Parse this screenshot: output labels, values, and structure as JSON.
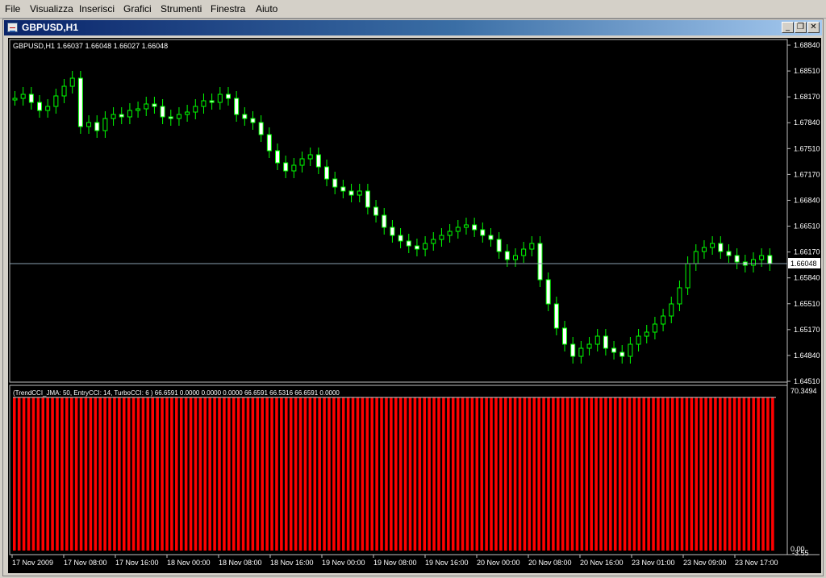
{
  "menu": {
    "items": [
      "File",
      "Visualizza",
      "Inserisci",
      "Grafici",
      "Strumenti",
      "Finestra",
      "Aiuto"
    ]
  },
  "window": {
    "title": "GBPUSD,H1",
    "minimize_icon": "minimize-icon",
    "restore_icon": "restore-icon",
    "close_icon": "close-icon"
  },
  "chart": {
    "header": "GBPUSD,H1  1.66037 1.66048 1.66027 1.66048",
    "current_price_label": "1.66048",
    "price_ticks": [
      "1.68840",
      "1.68510",
      "1.68170",
      "1.67840",
      "1.67510",
      "1.67170",
      "1.66840",
      "1.66510",
      "1.66170",
      "1.65840",
      "1.65510",
      "1.65170",
      "1.64840",
      "1.64510"
    ],
    "time_ticks": [
      "17 Nov 2009",
      "17 Nov 08:00",
      "17 Nov 16:00",
      "18 Nov 00:00",
      "18 Nov 08:00",
      "18 Nov 16:00",
      "19 Nov 00:00",
      "19 Nov 08:00",
      "19 Nov 16:00",
      "20 Nov 00:00",
      "20 Nov 08:00",
      "20 Nov 16:00",
      "23 Nov 01:00",
      "23 Nov 09:00",
      "23 Nov 17:00"
    ],
    "colors": {
      "background": "#000000",
      "candle_up": "#000000",
      "candle_down": "#ffffff",
      "wick": "#00ff00",
      "grid_line": "#708090",
      "histogram": "#ff0000"
    }
  },
  "indicator": {
    "label": "(TrendCCI_JMA: 50, EntryCCI: 14, TurboCCI: 6 ) 66.6591 0.0000 0.0000 0.0000 66.6591 66.5316 66.6591 0.0000",
    "max_label": "70.3494",
    "zero_label": "0.00",
    "neg_label": "-3.55"
  }
}
